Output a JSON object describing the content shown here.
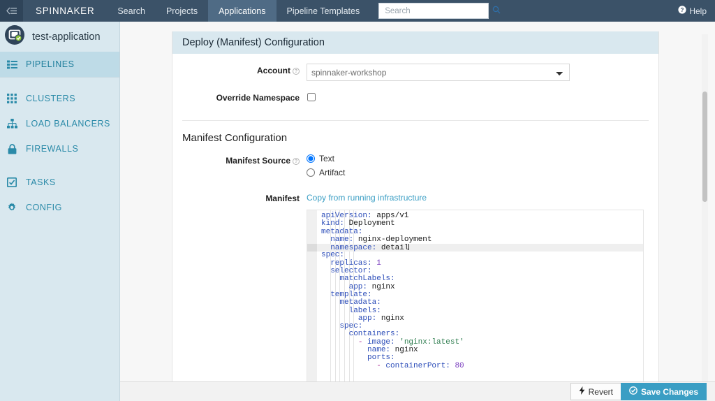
{
  "topnav": {
    "collapse_icon": "collapse-left-icon",
    "brand": "SPINNAKER",
    "tabs": [
      {
        "label": "Search",
        "active": false
      },
      {
        "label": "Projects",
        "active": false
      },
      {
        "label": "Applications",
        "active": true
      },
      {
        "label": "Pipeline Templates",
        "active": false
      }
    ],
    "search": {
      "value": "",
      "placeholder": "Search",
      "icon": "search-icon"
    },
    "help": {
      "label": "Help",
      "icon": "help-circle-icon"
    }
  },
  "sidebar": {
    "app_name": "test-application",
    "avatar_icon": "application-window-check-icon",
    "items": [
      {
        "label": "PIPELINES",
        "icon": "list-icon",
        "active": true
      },
      {
        "label": "CLUSTERS",
        "icon": "grid-icon",
        "active": false
      },
      {
        "label": "LOAD BALANCERS",
        "icon": "sitemap-icon",
        "active": false
      },
      {
        "label": "FIREWALLS",
        "icon": "lock-icon",
        "active": false
      },
      {
        "label": "TASKS",
        "icon": "checkbox-checked-icon",
        "active": false
      },
      {
        "label": "CONFIG",
        "icon": "gear-icon",
        "active": false
      }
    ]
  },
  "panel": {
    "title": "Deploy (Manifest) Configuration",
    "account": {
      "label": "Account",
      "help_icon": "help-circle-icon",
      "selected": "spinnaker-workshop",
      "options": [
        "spinnaker-workshop"
      ]
    },
    "override_namespace": {
      "label": "Override Namespace",
      "checked": false
    },
    "manifest_section": {
      "title": "Manifest Configuration",
      "source": {
        "label": "Manifest Source",
        "help_icon": "help-circle-icon",
        "options": [
          {
            "label": "Text",
            "selected": true
          },
          {
            "label": "Artifact",
            "selected": false
          }
        ]
      },
      "manifest": {
        "label": "Manifest",
        "copy_link": "Copy from running infrastructure",
        "active_line_index": 4,
        "lines": [
          {
            "indent": 0,
            "key": "apiVersion",
            "value": "apps/v1",
            "type": "plain"
          },
          {
            "indent": 0,
            "key": "kind",
            "value": "Deployment",
            "type": "plain"
          },
          {
            "indent": 0,
            "key": "metadata",
            "value": "",
            "type": "plain"
          },
          {
            "indent": 1,
            "key": "name",
            "value": "nginx-deployment",
            "type": "plain"
          },
          {
            "indent": 1,
            "key": "namespace",
            "value": "detail",
            "type": "plain"
          },
          {
            "indent": 0,
            "key": "spec",
            "value": "",
            "type": "plain"
          },
          {
            "indent": 1,
            "key": "replicas",
            "value": "1",
            "type": "number"
          },
          {
            "indent": 1,
            "key": "selector",
            "value": "",
            "type": "plain"
          },
          {
            "indent": 2,
            "key": "matchLabels",
            "value": "",
            "type": "plain"
          },
          {
            "indent": 3,
            "key": "app",
            "value": "nginx",
            "type": "plain"
          },
          {
            "indent": 1,
            "key": "template",
            "value": "",
            "type": "plain"
          },
          {
            "indent": 2,
            "key": "metadata",
            "value": "",
            "type": "plain"
          },
          {
            "indent": 3,
            "key": "labels",
            "value": "",
            "type": "plain"
          },
          {
            "indent": 4,
            "key": "app",
            "value": "nginx",
            "type": "plain"
          },
          {
            "indent": 2,
            "key": "spec",
            "value": "",
            "type": "plain"
          },
          {
            "indent": 3,
            "key": "containers",
            "value": "",
            "type": "plain"
          },
          {
            "indent": 4,
            "key": "image",
            "value": "'nginx:latest'",
            "type": "string",
            "dash": true
          },
          {
            "indent": 5,
            "key": "name",
            "value": "nginx",
            "type": "plain"
          },
          {
            "indent": 5,
            "key": "ports",
            "value": "",
            "type": "plain"
          },
          {
            "indent": 6,
            "key": "containerPort",
            "value": "80",
            "type": "number",
            "dash": true
          }
        ]
      }
    }
  },
  "footer": {
    "revert": {
      "label": "Revert",
      "icon": "bolt-icon"
    },
    "save": {
      "label": "Save Changes",
      "icon": "check-circle-icon"
    }
  },
  "colors": {
    "nav_bg": "#3b5268",
    "nav_active": "#4f6b85",
    "sidebar_bg": "#d9e8ef",
    "sidebar_active": "#bedbe7",
    "accent_teal": "#2a8aa8",
    "link_blue": "#3a9ec4",
    "save_button": "#3a9ec4",
    "panel_header": "#d9e8ef"
  }
}
